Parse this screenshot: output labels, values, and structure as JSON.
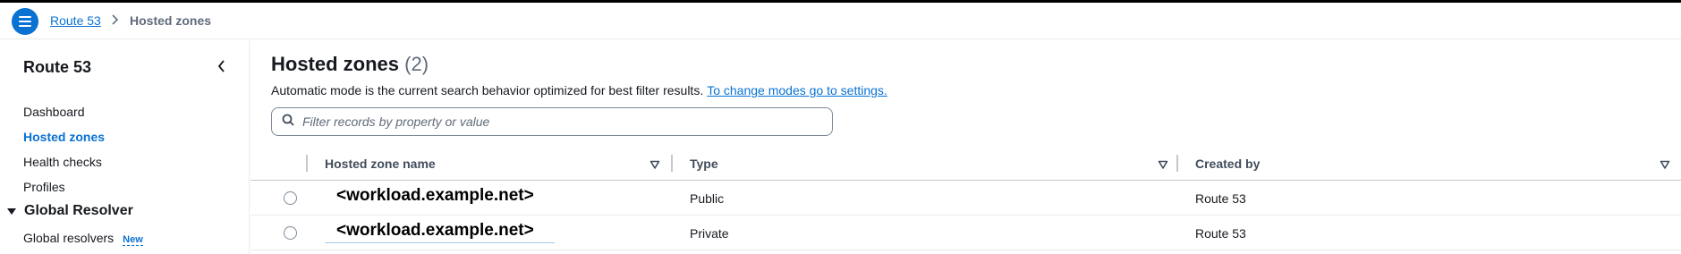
{
  "breadcrumb": {
    "menu_icon": "hamburger-menu-icon",
    "items": [
      "Route 53",
      "Hosted zones"
    ],
    "separator": ">"
  },
  "sidebar": {
    "title": "Route 53",
    "collapse_icon": "chevron-left-icon",
    "items": [
      {
        "label": "Dashboard",
        "active": false
      },
      {
        "label": "Hosted zones",
        "active": true
      },
      {
        "label": "Health checks",
        "active": false
      },
      {
        "label": "Profiles",
        "active": false
      }
    ],
    "section": {
      "label": "Global Resolver",
      "expanded": true,
      "items": [
        {
          "label": "Global resolvers",
          "badge": "New"
        }
      ]
    }
  },
  "main": {
    "title": "Hosted zones",
    "count": "(2)",
    "description": "Automatic mode is the current search behavior optimized for best filter results.",
    "description_link": "To change modes go to settings.",
    "search": {
      "placeholder": "Filter records by property or value",
      "value": "",
      "icon": "search-icon"
    },
    "table": {
      "columns": [
        "Hosted zone name",
        "Type",
        "Created by"
      ],
      "rows": [
        {
          "name": "<workload.example.net>",
          "type": "Public",
          "created_by": "Route 53"
        },
        {
          "name": "<workload.example.net>",
          "type": "Private",
          "created_by": "Route 53"
        }
      ]
    }
  },
  "colors": {
    "accent": "#0972d3",
    "text": "#16191f",
    "muted": "#5f6b7a",
    "border": "#c6c6cd"
  }
}
